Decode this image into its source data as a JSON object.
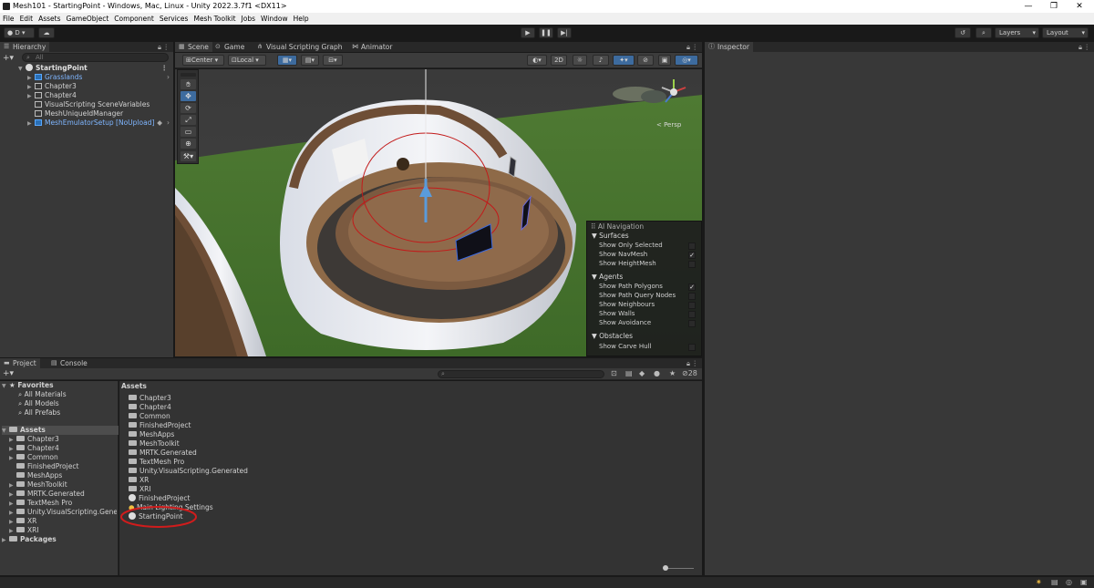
{
  "window": {
    "title": "Mesh101 - StartingPoint - Windows, Mac, Linux - Unity 2022.3.7f1 <DX11>",
    "controls": [
      "—",
      "❐",
      "✕"
    ]
  },
  "menu": [
    "File",
    "Edit",
    "Assets",
    "GameObject",
    "Component",
    "Services",
    "Mesh Toolkit",
    "Jobs",
    "Window",
    "Help"
  ],
  "toolbar": {
    "account_label": "D",
    "layers_label": "Layers",
    "layout_label": "Layout"
  },
  "hierarchy": {
    "tab_label": "Hierarchy",
    "search_placeholder": "All",
    "scene_name": "StartingPoint",
    "items": [
      {
        "label": "Grasslands",
        "type": "prefab"
      },
      {
        "label": "Chapter3",
        "type": "object"
      },
      {
        "label": "Chapter4",
        "type": "object"
      },
      {
        "label": "VisualScripting SceneVariables",
        "type": "object"
      },
      {
        "label": "MeshUniqueIdManager",
        "type": "object"
      },
      {
        "label": "MeshEmulatorSetup [NoUpload]",
        "type": "prefab"
      }
    ]
  },
  "scene_tabs": [
    "Scene",
    "Game",
    "Visual Scripting Graph",
    "Animator"
  ],
  "scene_toolbar": {
    "pivot": "Center",
    "space": "Local",
    "mode_2d": "2D"
  },
  "gizmo": {
    "persp_label": "< Persp"
  },
  "ai_navigation": {
    "title": "AI Navigation",
    "sections": [
      {
        "title": "Surfaces",
        "rows": [
          {
            "label": "Show Only Selected",
            "checked": false
          },
          {
            "label": "Show NavMesh",
            "checked": true
          },
          {
            "label": "Show HeightMesh",
            "checked": false
          }
        ]
      },
      {
        "title": "Agents",
        "rows": [
          {
            "label": "Show Path Polygons",
            "checked": true
          },
          {
            "label": "Show Path Query Nodes",
            "checked": false
          },
          {
            "label": "Show Neighbours",
            "checked": false
          },
          {
            "label": "Show Walls",
            "checked": false
          },
          {
            "label": "Show Avoidance",
            "checked": false
          }
        ]
      },
      {
        "title": "Obstacles",
        "rows": [
          {
            "label": "Show Carve Hull",
            "checked": false
          }
        ]
      }
    ],
    "check_glyph": "✓"
  },
  "inspector": {
    "tab_label": "Inspector"
  },
  "project": {
    "tabs": [
      "Project",
      "Console"
    ],
    "hidden_count": "28",
    "favorites": {
      "title": "Favorites",
      "items": [
        "All Materials",
        "All Models",
        "All Prefabs"
      ]
    },
    "assets_tree": {
      "title": "Assets",
      "items": [
        "Chapter3",
        "Chapter4",
        "Common",
        "FinishedProject",
        "MeshApps",
        "MeshToolkit",
        "MRTK.Generated",
        "TextMesh Pro",
        "Unity.VisualScripting.Generated",
        "XR",
        "XRI"
      ]
    },
    "packages_label": "Packages",
    "breadcrumb": "Assets",
    "content": [
      {
        "label": "Chapter3",
        "type": "folder"
      },
      {
        "label": "Chapter4",
        "type": "folder"
      },
      {
        "label": "Common",
        "type": "folder"
      },
      {
        "label": "FinishedProject",
        "type": "folder"
      },
      {
        "label": "MeshApps",
        "type": "folder"
      },
      {
        "label": "MeshToolkit",
        "type": "folder"
      },
      {
        "label": "MRTK.Generated",
        "type": "folder"
      },
      {
        "label": "TextMesh Pro",
        "type": "folder"
      },
      {
        "label": "Unity.VisualScripting.Generated",
        "type": "folder"
      },
      {
        "label": "XR",
        "type": "folder"
      },
      {
        "label": "XRI",
        "type": "folder"
      },
      {
        "label": "FinishedProject",
        "type": "scene"
      },
      {
        "label": "Main Lighting Settings",
        "type": "lighting"
      },
      {
        "label": "StartingPoint",
        "type": "scene"
      }
    ]
  },
  "colors": {
    "annotation_circle": "#d01c1c",
    "selection_blue": "#7fb6ff",
    "panel_bg": "#383838"
  }
}
